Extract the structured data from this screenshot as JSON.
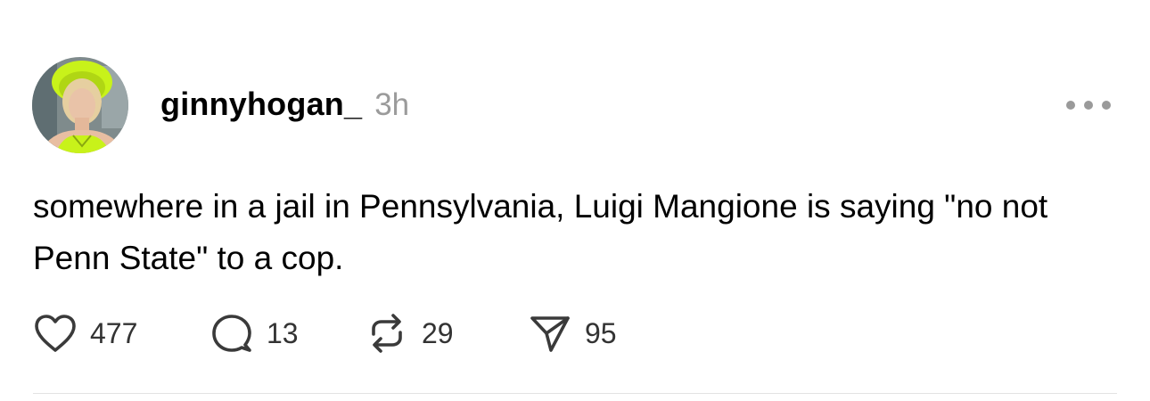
{
  "post": {
    "author": {
      "username": "ginnyhogan_",
      "avatar_icon": "profile-photo"
    },
    "timestamp": "3h",
    "more_icon": "more-horizontal-icon",
    "text": "somewhere in a jail in Pennsylvania, Luigi Mangione is saying \"no not Penn State\" to a cop.",
    "actions": {
      "like": {
        "icon": "heart-icon",
        "count": "477"
      },
      "reply": {
        "icon": "comment-icon",
        "count": "13"
      },
      "repost": {
        "icon": "repost-icon",
        "count": "29"
      },
      "share": {
        "icon": "send-icon",
        "count": "95"
      }
    }
  },
  "colors": {
    "text": "#000000",
    "muted": "#9b9b9b",
    "icon": "#3a3a3a",
    "divider": "#e3e3e3",
    "avatar_accent": "#c8f21a"
  }
}
